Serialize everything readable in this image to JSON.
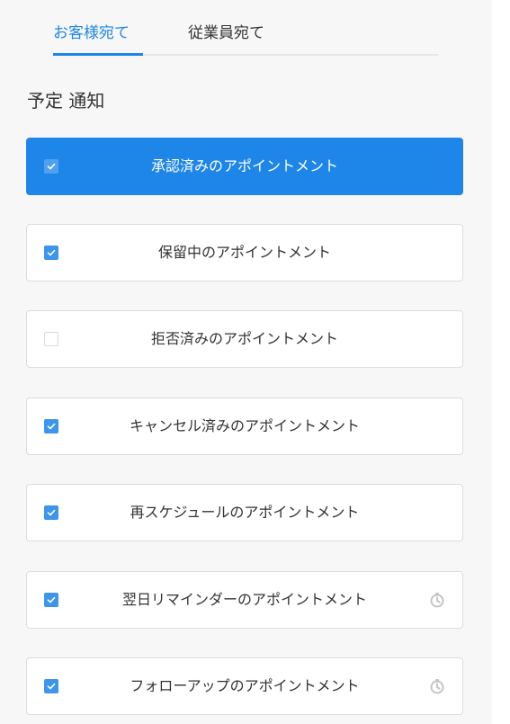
{
  "tabs": [
    {
      "label": "お客様宛て",
      "active": true
    },
    {
      "label": "従業員宛て",
      "active": false
    }
  ],
  "section_title": "予定 通知",
  "items": [
    {
      "label": "承認済みのアポイントメント",
      "checked": true,
      "selected": true,
      "timer_icon": false
    },
    {
      "label": "保留中のアポイントメント",
      "checked": true,
      "selected": false,
      "timer_icon": false
    },
    {
      "label": "拒否済みのアポイントメント",
      "checked": false,
      "selected": false,
      "timer_icon": false
    },
    {
      "label": "キャンセル済みのアポイントメント",
      "checked": true,
      "selected": false,
      "timer_icon": false
    },
    {
      "label": "再スケジュールのアポイントメント",
      "checked": true,
      "selected": false,
      "timer_icon": false
    },
    {
      "label": "翌日リマインダーのアポイントメント",
      "checked": true,
      "selected": false,
      "timer_icon": true
    },
    {
      "label": "フォローアップのアポイントメント",
      "checked": true,
      "selected": false,
      "timer_icon": true
    }
  ],
  "colors": {
    "accent": "#1e86e8",
    "background": "#f7f7f7",
    "text": "#333333"
  }
}
